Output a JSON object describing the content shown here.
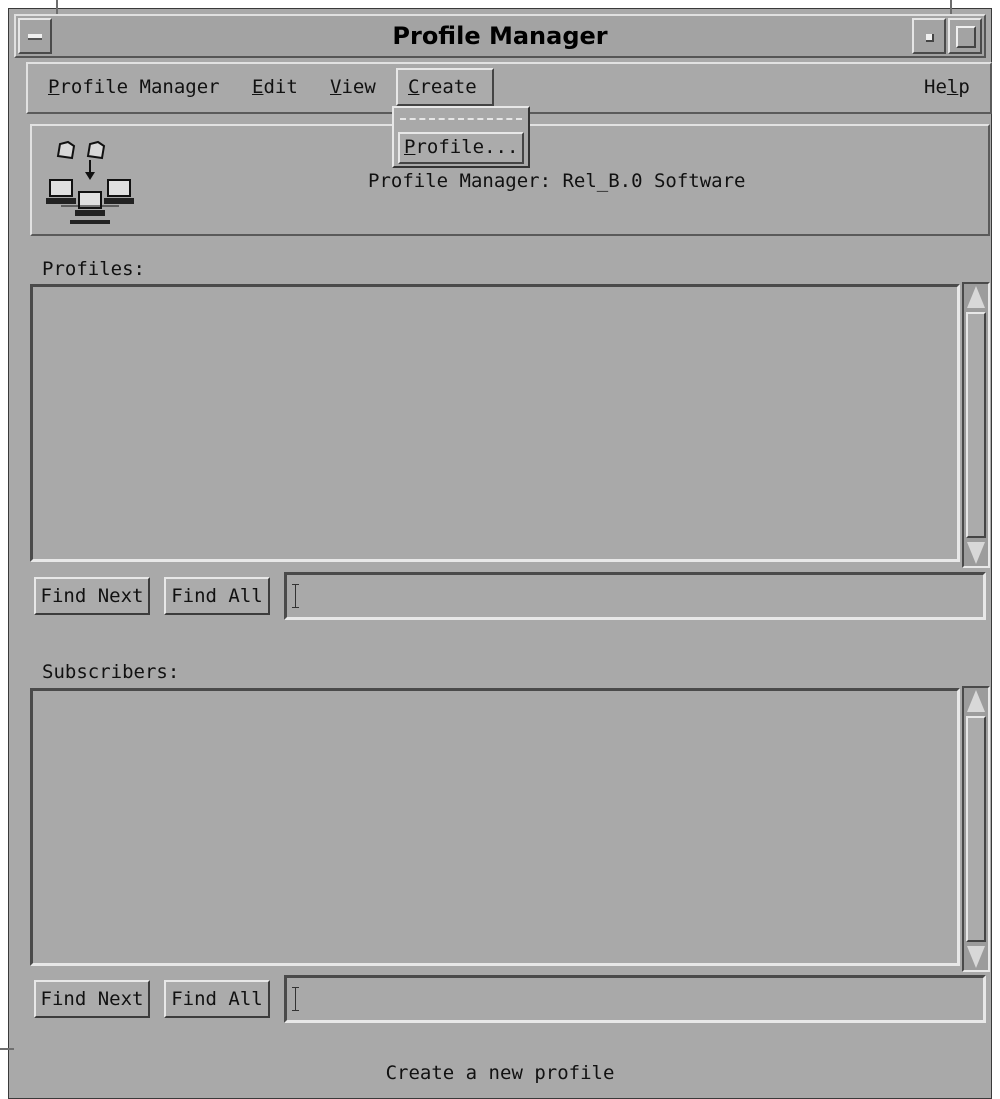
{
  "window": {
    "title": "Profile Manager"
  },
  "menubar": {
    "items": [
      {
        "label": "Profile Manager",
        "mnemonic": "P",
        "rest": "rofile Manager"
      },
      {
        "label": "Edit",
        "mnemonic": "E",
        "rest": "dit"
      },
      {
        "label": "View",
        "mnemonic": "V",
        "rest": "iew"
      },
      {
        "label": "Create",
        "mnemonic": "C",
        "rest": "reate"
      },
      {
        "label": "Help",
        "pre": "He",
        "mnemonic": "l",
        "rest": "p"
      }
    ],
    "open_menu": "Create"
  },
  "dropdown": {
    "items": [
      {
        "label": "Profile...",
        "mnemonic": "P",
        "rest": "rofile..."
      }
    ]
  },
  "header": {
    "text": "Profile Manager: Rel_B.0 Software",
    "icon": "profile-manager-network-icon"
  },
  "profiles": {
    "label": "Profiles:",
    "items": [],
    "find_next_label": "Find Next",
    "find_all_label": "Find All",
    "search_value": ""
  },
  "subscribers": {
    "label": "Subscribers:",
    "items": [],
    "find_next_label": "Find Next",
    "find_all_label": "Find All",
    "search_value": ""
  },
  "status": {
    "text": "Create a new profile"
  },
  "colors": {
    "background": "#a9a9a9",
    "bevel_light": "#e8e8e8",
    "bevel_dark": "#4a4a4a"
  }
}
